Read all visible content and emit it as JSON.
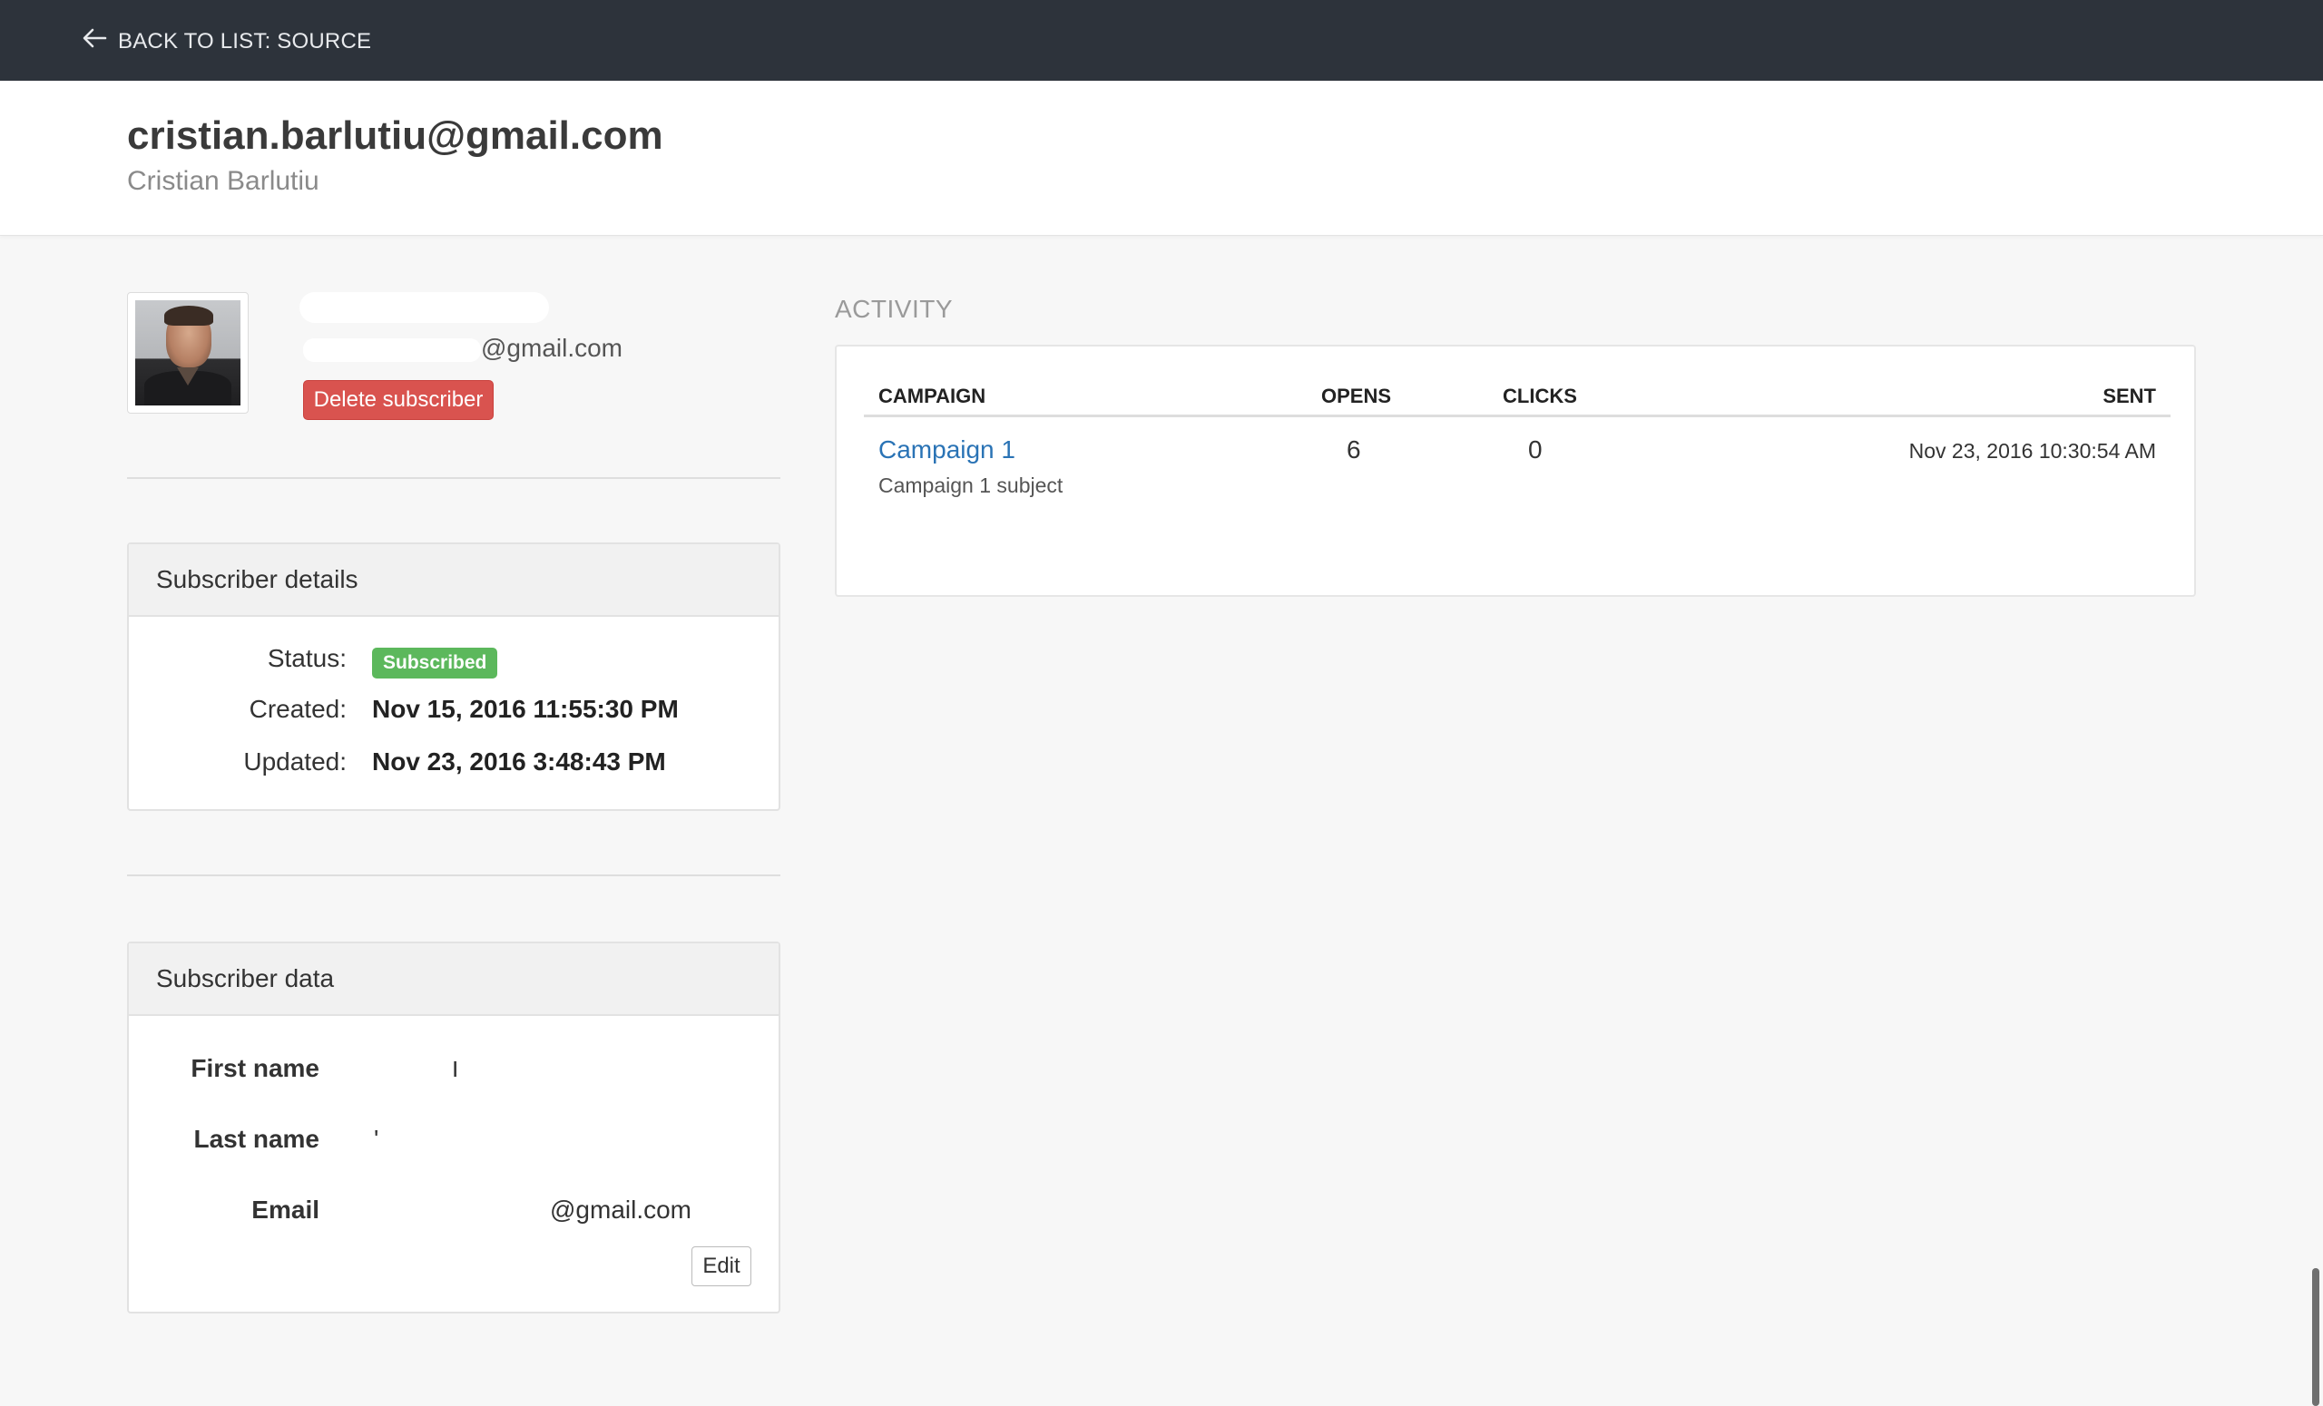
{
  "topbar": {
    "back_label": "BACK TO LIST: SOURCE"
  },
  "header": {
    "email": "cristian.barlutiu@gmail.com",
    "name": "Cristian Barlutiu"
  },
  "profile": {
    "email_suffix": "@gmail.com",
    "delete_label": "Delete subscriber"
  },
  "details_panel": {
    "title": "Subscriber details",
    "status_label": "Status:",
    "status_value": "Subscribed",
    "created_label": "Created:",
    "created_value": "Nov 15, 2016 11:55:30 PM",
    "updated_label": "Updated:",
    "updated_value": "Nov 23, 2016 3:48:43 PM"
  },
  "data_panel": {
    "title": "Subscriber data",
    "first_name_label": "First name",
    "first_name_value": "ו",
    "last_name_label": "Last name",
    "last_name_value": "'",
    "email_label": "Email",
    "email_value": "@gmail.com",
    "edit_label": "Edit"
  },
  "activity": {
    "title": "ACTIVITY",
    "columns": {
      "campaign": "CAMPAIGN",
      "opens": "OPENS",
      "clicks": "CLICKS",
      "sent": "SENT"
    },
    "rows": [
      {
        "campaign": "Campaign 1",
        "subject": "Campaign 1 subject",
        "opens": "6",
        "clicks": "0",
        "sent": "Nov 23, 2016 10:30:54 AM"
      }
    ]
  },
  "colors": {
    "topbar": "#2d333b",
    "danger": "#d9534f",
    "success": "#5cb85c",
    "link": "#2a73b5"
  },
  "icons": {
    "back": "arrow-left-icon"
  }
}
